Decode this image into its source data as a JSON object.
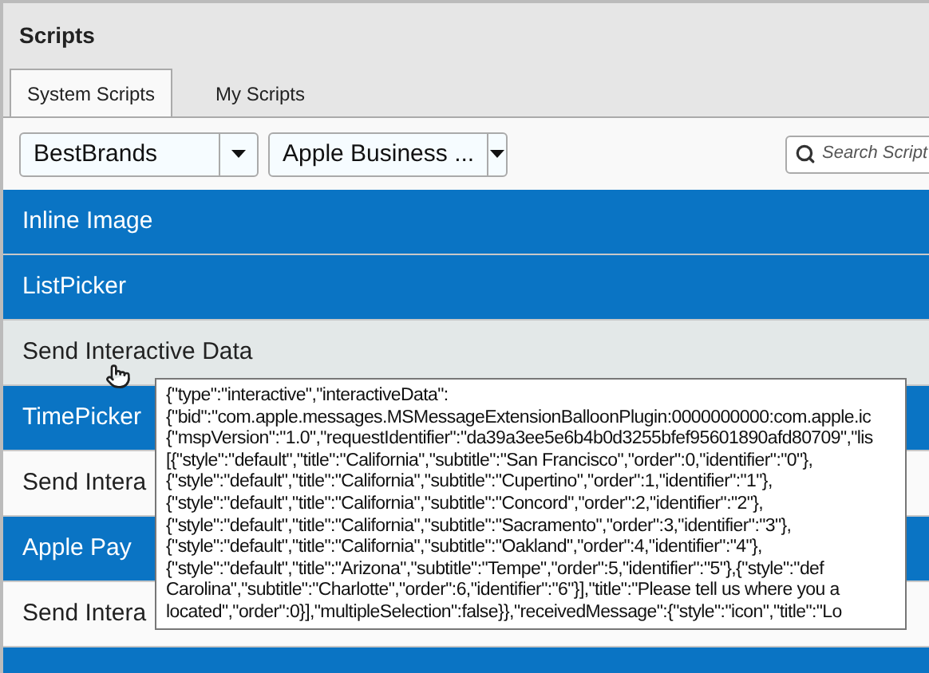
{
  "panel": {
    "title": "Scripts"
  },
  "tabs": [
    {
      "label": "System Scripts",
      "selected": true
    },
    {
      "label": "My Scripts",
      "selected": false
    }
  ],
  "filters": [
    {
      "value": "BestBrands"
    },
    {
      "value": "Apple Business ..."
    }
  ],
  "search": {
    "placeholder": "Search Script"
  },
  "scripts": [
    {
      "label": "Inline Image",
      "kind": "category",
      "hovered": false
    },
    {
      "label": "ListPicker",
      "kind": "category",
      "hovered": false
    },
    {
      "label": "Send Interactive Data",
      "kind": "script",
      "hovered": true
    },
    {
      "label": "TimePicker",
      "kind": "category",
      "hovered": false
    },
    {
      "label": "Send Intera",
      "kind": "script",
      "hovered": false
    },
    {
      "label": "Apple Pay",
      "kind": "category",
      "hovered": false
    },
    {
      "label": "Send Intera",
      "kind": "script",
      "hovered": false
    },
    {
      "kind": "category",
      "hovered": false
    }
  ],
  "tooltip": {
    "lines": [
      "{\"type\":\"interactive\",\"interactiveData\":",
      "{\"bid\":\"com.apple.messages.MSMessageExtensionBalloonPlugin:0000000000:com.apple.ic",
      "{\"mspVersion\":\"1.0\",\"requestIdentifier\":\"da39a3ee5e6b4b0d3255bfef95601890afd80709\",\"lis",
      "[{\"style\":\"default\",\"title\":\"California\",\"subtitle\":\"San Francisco\",\"order\":0,\"identifier\":\"0\"},",
      "{\"style\":\"default\",\"title\":\"California\",\"subtitle\":\"Cupertino\",\"order\":1,\"identifier\":\"1\"},",
      "{\"style\":\"default\",\"title\":\"California\",\"subtitle\":\"Concord\",\"order\":2,\"identifier\":\"2\"},",
      "{\"style\":\"default\",\"title\":\"California\",\"subtitle\":\"Sacramento\",\"order\":3,\"identifier\":\"3\"},",
      "{\"style\":\"default\",\"title\":\"California\",\"subtitle\":\"Oakland\",\"order\":4,\"identifier\":\"4\"},",
      "{\"style\":\"default\",\"title\":\"Arizona\",\"subtitle\":\"Tempe\",\"order\":5,\"identifier\":\"5\"},{\"style\":\"def",
      "Carolina\",\"subtitle\":\"Charlotte\",\"order\":6,\"identifier\":\"6\"}],\"title\":\"Please tell us where you a",
      "located\",\"order\":0}],\"multipleSelection\":false}},\"receivedMessage\":{\"style\":\"icon\",\"title\":\"Lo"
    ]
  }
}
